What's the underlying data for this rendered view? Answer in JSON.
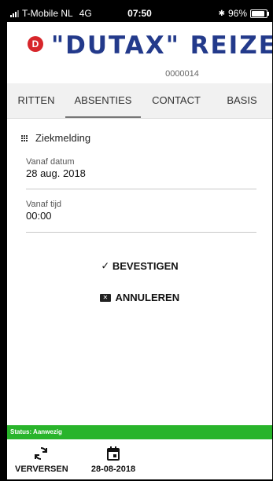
{
  "statusbar": {
    "carrier": "T-Mobile NL",
    "network": "4G",
    "time": "07:50",
    "bluetooth": "✱",
    "battery": "96%"
  },
  "header": {
    "logo_mark": "D",
    "logo_text": "\"DUTAX\" REIZEN",
    "code": "0000014"
  },
  "tabs": [
    {
      "label": "RITTEN",
      "active": false
    },
    {
      "label": "ABSENTIES",
      "active": true
    },
    {
      "label": "CONTACT",
      "active": false
    },
    {
      "label": "BASIS",
      "active": false
    }
  ],
  "form": {
    "section_title": "Ziekmelding",
    "fields": [
      {
        "label": "Vanaf datum",
        "value": "28 aug. 2018"
      },
      {
        "label": "Vanaf tijd",
        "value": "00:00"
      }
    ]
  },
  "actions": {
    "confirm_label": "BEVESTIGEN",
    "cancel_label": "ANNULEREN"
  },
  "footer": {
    "status_text": "Status: Aanwezig",
    "refresh_label": "VERVERSEN",
    "date_label": "28-08-2018"
  },
  "colors": {
    "brand_blue": "#233a8b",
    "brand_red": "#d7262b",
    "status_green": "#29b42b"
  }
}
